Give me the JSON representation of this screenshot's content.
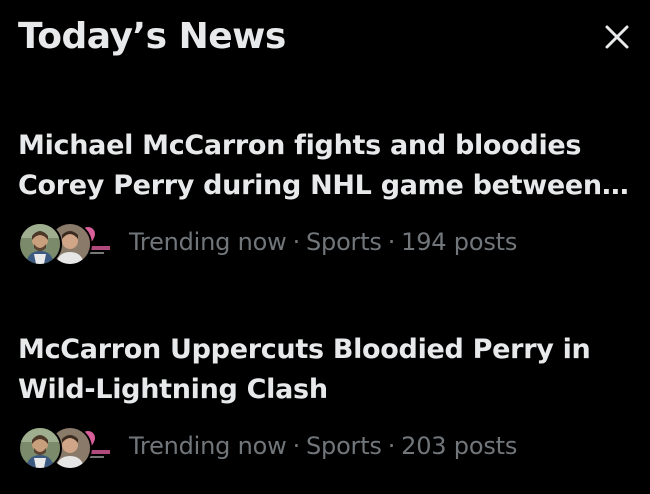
{
  "header": {
    "title": "Today’s News",
    "close_icon": "close-icon"
  },
  "stories": [
    {
      "headline": "Michael McCarron fights and bloodies Corey Perry during NHL game between Nashville Predators and Tampa Bay Lightning",
      "status": "Trending now",
      "category": "Sports",
      "posts": "194 posts",
      "avatar_icons": [
        "avatar-person-icon",
        "avatar-person-icon",
        "avatar-brand-logo-icon"
      ]
    },
    {
      "headline": "McCarron Uppercuts Bloodied Perry in Wild-Lightning Clash",
      "status": "Trending now",
      "category": "Sports",
      "posts": "203 posts",
      "avatar_icons": [
        "avatar-person-icon",
        "avatar-person-icon",
        "avatar-brand-logo-icon"
      ]
    }
  ],
  "colors": {
    "background": "#000000",
    "primary_text": "#e7e9ea",
    "secondary_text": "#71767b",
    "logo_pink": "#d95f9a"
  }
}
